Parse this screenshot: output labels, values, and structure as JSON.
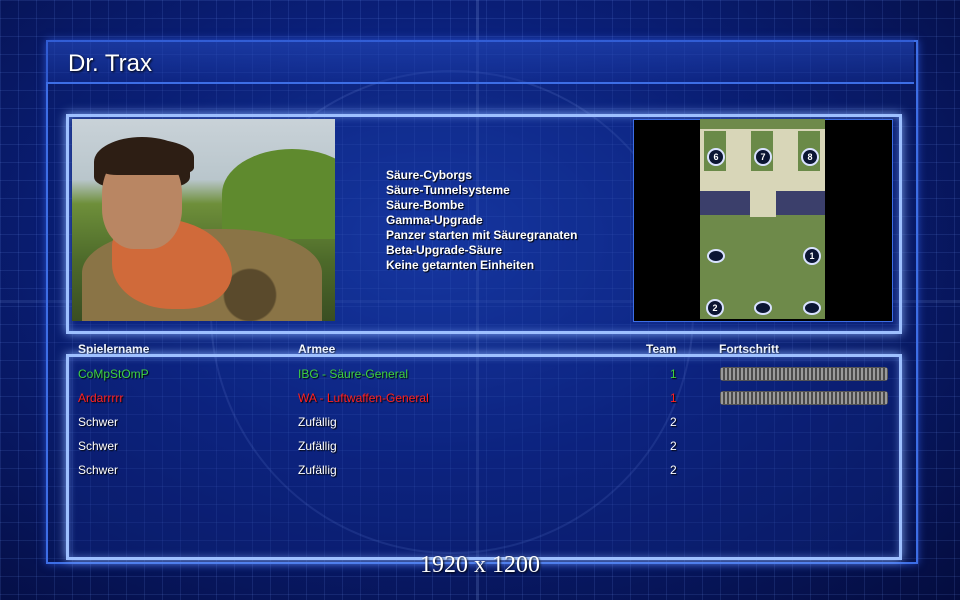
{
  "colors": {
    "player_green": "#3fd23f",
    "player_red": "#ff2020",
    "player_default": "#ffffff",
    "frame_blue": "#3d6ee6",
    "panel_border": "#9ec0ff"
  },
  "header": {
    "title": "Dr. Trax"
  },
  "briefing": {
    "lines": [
      "Säure-Cyborgs",
      "Säure-Tunnelsysteme",
      "Säure-Bombe",
      "Gamma-Upgrade",
      "Panzer starten mit Säuregranaten",
      "Beta-Upgrade-Säure",
      "Keine getarnten Einheiten"
    ]
  },
  "minimap": {
    "start_positions": [
      "6",
      "7",
      "8",
      "1",
      "2"
    ]
  },
  "players": {
    "columns": {
      "name": "Spielername",
      "army": "Armee",
      "team": "Team",
      "progress": "Fortschritt"
    },
    "rows": [
      {
        "name": "CoMpStOmP",
        "army": "IBG - Säure-General",
        "team": "1",
        "progress": 1.0,
        "color": "#3fd23f"
      },
      {
        "name": "Ardarrrrr",
        "army": "WA - Luftwaffen-General",
        "team": "1",
        "progress": 1.0,
        "color": "#ff2020"
      },
      {
        "name": "Schwer",
        "army": "Zufällig",
        "team": "2",
        "color": "#ffffff"
      },
      {
        "name": "Schwer",
        "army": "Zufällig",
        "team": "2",
        "color": "#ffffff"
      },
      {
        "name": "Schwer",
        "army": "Zufällig",
        "team": "2",
        "color": "#ffffff"
      }
    ]
  },
  "footer": {
    "resolution": "1920 x 1200"
  }
}
